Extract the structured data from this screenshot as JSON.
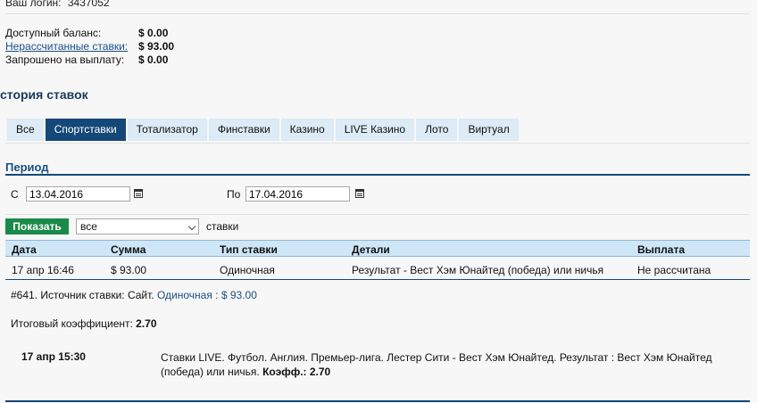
{
  "account": {
    "login_label": "Ваш логин:",
    "login_value": "3437052",
    "balance_label": "Доступный баланс:",
    "balance_value": "$ 0.00",
    "unsettled_label": "Нерассчитанные ставки:",
    "unsettled_value": "$ 93.00",
    "payout_label": "Запрошено на выплату:",
    "payout_value": "$ 0.00"
  },
  "history": {
    "title": "стория ставок",
    "tabs": [
      {
        "label": "Все",
        "active": false
      },
      {
        "label": "Спортставки",
        "active": true
      },
      {
        "label": "Тотализатор",
        "active": false
      },
      {
        "label": "Финставки",
        "active": false
      },
      {
        "label": "Казино",
        "active": false
      },
      {
        "label": "LIVE Казино",
        "active": false
      },
      {
        "label": "Лото",
        "active": false
      },
      {
        "label": "Виртуал",
        "active": false
      }
    ]
  },
  "period": {
    "title": "Период",
    "from_label": "С",
    "from_value": "13.04.2016",
    "to_label": "По",
    "to_value": "17.04.2016",
    "show_button": "Показать",
    "filter_selected": "все",
    "filter_suffix": "ставки"
  },
  "table": {
    "headers": [
      "Дата",
      "Сумма",
      "Тип ставки",
      "Детали",
      "Выплата"
    ],
    "row": {
      "date": "17 апр 16:46",
      "amount": "$ 93.00",
      "type": "Одиночная",
      "details": "Результат - Вест Хэм Юнайтед (победа) или ничья",
      "payout": "Не рассчитана"
    }
  },
  "bet_detail": {
    "id_source": "#641. Источник ставки: Сайт.",
    "type_amount": "Одиночная : $ 93.00",
    "total_coef_label": "Итоговый коэффициент:",
    "total_coef_value": "2.70",
    "event_time": "17 апр 15:30",
    "event_line1": "Ставки LIVE. Футбол. Англия. Премьер-лига. Лестер Сити - Вест Хэм Юнайтед. Результат : Вест Хэм Юнайтед",
    "event_line2": "(победа) или ничья.",
    "coef_label": "Коэфф.:",
    "coef_value": "2.70"
  },
  "colors": {
    "accent": "#144878",
    "tab_bg": "#dcebf5",
    "header_bg": "#cfe6f7",
    "button_green": "#1a8a4a"
  },
  "icons": {
    "from_calendar": "calendar-icon",
    "to_calendar": "calendar-icon",
    "select_arrow": "chevron-down-icon"
  }
}
